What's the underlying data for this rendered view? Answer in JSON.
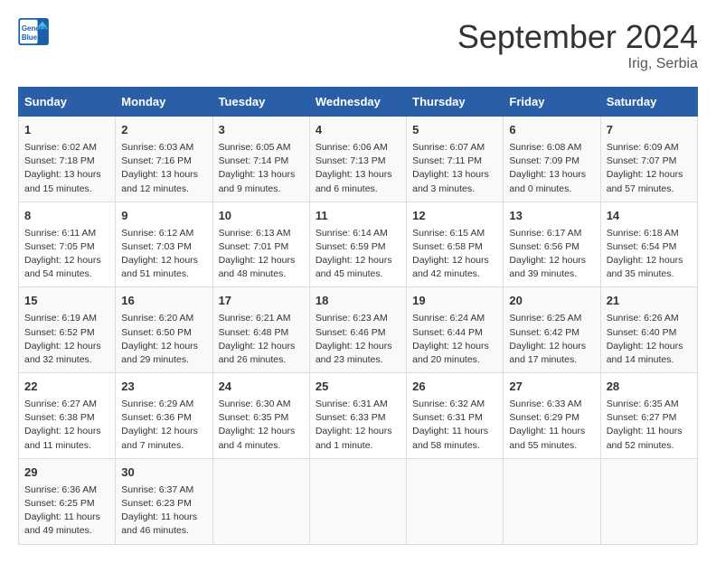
{
  "header": {
    "logo_line1": "General",
    "logo_line2": "Blue",
    "month": "September 2024",
    "location": "Irig, Serbia"
  },
  "weekdays": [
    "Sunday",
    "Monday",
    "Tuesday",
    "Wednesday",
    "Thursday",
    "Friday",
    "Saturday"
  ],
  "weeks": [
    [
      {
        "day": "1",
        "info": "Sunrise: 6:02 AM\nSunset: 7:18 PM\nDaylight: 13 hours\nand 15 minutes."
      },
      {
        "day": "2",
        "info": "Sunrise: 6:03 AM\nSunset: 7:16 PM\nDaylight: 13 hours\nand 12 minutes."
      },
      {
        "day": "3",
        "info": "Sunrise: 6:05 AM\nSunset: 7:14 PM\nDaylight: 13 hours\nand 9 minutes."
      },
      {
        "day": "4",
        "info": "Sunrise: 6:06 AM\nSunset: 7:13 PM\nDaylight: 13 hours\nand 6 minutes."
      },
      {
        "day": "5",
        "info": "Sunrise: 6:07 AM\nSunset: 7:11 PM\nDaylight: 13 hours\nand 3 minutes."
      },
      {
        "day": "6",
        "info": "Sunrise: 6:08 AM\nSunset: 7:09 PM\nDaylight: 13 hours\nand 0 minutes."
      },
      {
        "day": "7",
        "info": "Sunrise: 6:09 AM\nSunset: 7:07 PM\nDaylight: 12 hours\nand 57 minutes."
      }
    ],
    [
      {
        "day": "8",
        "info": "Sunrise: 6:11 AM\nSunset: 7:05 PM\nDaylight: 12 hours\nand 54 minutes."
      },
      {
        "day": "9",
        "info": "Sunrise: 6:12 AM\nSunset: 7:03 PM\nDaylight: 12 hours\nand 51 minutes."
      },
      {
        "day": "10",
        "info": "Sunrise: 6:13 AM\nSunset: 7:01 PM\nDaylight: 12 hours\nand 48 minutes."
      },
      {
        "day": "11",
        "info": "Sunrise: 6:14 AM\nSunset: 6:59 PM\nDaylight: 12 hours\nand 45 minutes."
      },
      {
        "day": "12",
        "info": "Sunrise: 6:15 AM\nSunset: 6:58 PM\nDaylight: 12 hours\nand 42 minutes."
      },
      {
        "day": "13",
        "info": "Sunrise: 6:17 AM\nSunset: 6:56 PM\nDaylight: 12 hours\nand 39 minutes."
      },
      {
        "day": "14",
        "info": "Sunrise: 6:18 AM\nSunset: 6:54 PM\nDaylight: 12 hours\nand 35 minutes."
      }
    ],
    [
      {
        "day": "15",
        "info": "Sunrise: 6:19 AM\nSunset: 6:52 PM\nDaylight: 12 hours\nand 32 minutes."
      },
      {
        "day": "16",
        "info": "Sunrise: 6:20 AM\nSunset: 6:50 PM\nDaylight: 12 hours\nand 29 minutes."
      },
      {
        "day": "17",
        "info": "Sunrise: 6:21 AM\nSunset: 6:48 PM\nDaylight: 12 hours\nand 26 minutes."
      },
      {
        "day": "18",
        "info": "Sunrise: 6:23 AM\nSunset: 6:46 PM\nDaylight: 12 hours\nand 23 minutes."
      },
      {
        "day": "19",
        "info": "Sunrise: 6:24 AM\nSunset: 6:44 PM\nDaylight: 12 hours\nand 20 minutes."
      },
      {
        "day": "20",
        "info": "Sunrise: 6:25 AM\nSunset: 6:42 PM\nDaylight: 12 hours\nand 17 minutes."
      },
      {
        "day": "21",
        "info": "Sunrise: 6:26 AM\nSunset: 6:40 PM\nDaylight: 12 hours\nand 14 minutes."
      }
    ],
    [
      {
        "day": "22",
        "info": "Sunrise: 6:27 AM\nSunset: 6:38 PM\nDaylight: 12 hours\nand 11 minutes."
      },
      {
        "day": "23",
        "info": "Sunrise: 6:29 AM\nSunset: 6:36 PM\nDaylight: 12 hours\nand 7 minutes."
      },
      {
        "day": "24",
        "info": "Sunrise: 6:30 AM\nSunset: 6:35 PM\nDaylight: 12 hours\nand 4 minutes."
      },
      {
        "day": "25",
        "info": "Sunrise: 6:31 AM\nSunset: 6:33 PM\nDaylight: 12 hours\nand 1 minute."
      },
      {
        "day": "26",
        "info": "Sunrise: 6:32 AM\nSunset: 6:31 PM\nDaylight: 11 hours\nand 58 minutes."
      },
      {
        "day": "27",
        "info": "Sunrise: 6:33 AM\nSunset: 6:29 PM\nDaylight: 11 hours\nand 55 minutes."
      },
      {
        "day": "28",
        "info": "Sunrise: 6:35 AM\nSunset: 6:27 PM\nDaylight: 11 hours\nand 52 minutes."
      }
    ],
    [
      {
        "day": "29",
        "info": "Sunrise: 6:36 AM\nSunset: 6:25 PM\nDaylight: 11 hours\nand 49 minutes."
      },
      {
        "day": "30",
        "info": "Sunrise: 6:37 AM\nSunset: 6:23 PM\nDaylight: 11 hours\nand 46 minutes."
      },
      {
        "day": "",
        "info": ""
      },
      {
        "day": "",
        "info": ""
      },
      {
        "day": "",
        "info": ""
      },
      {
        "day": "",
        "info": ""
      },
      {
        "day": "",
        "info": ""
      }
    ]
  ]
}
